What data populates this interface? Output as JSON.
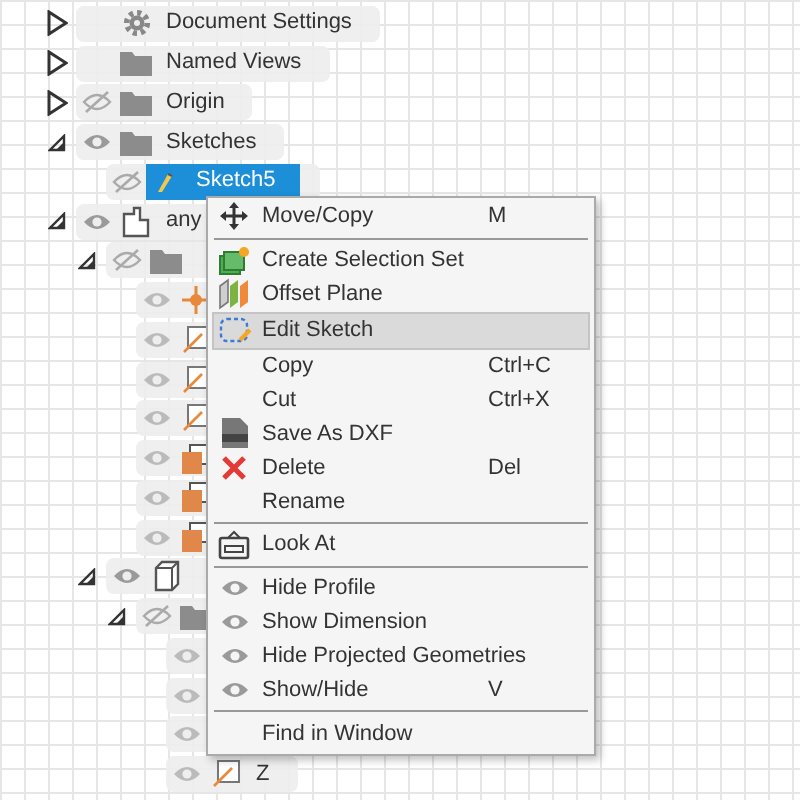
{
  "tree": [
    {
      "label": "Document Settings",
      "kind": "gear",
      "expanded": false,
      "selected": false
    },
    {
      "label": "Named Views",
      "kind": "folder",
      "expanded": false,
      "selected": false
    },
    {
      "label": "Origin",
      "kind": "folder",
      "expanded": false,
      "eye": false,
      "selected": false
    },
    {
      "label": "Sketches",
      "kind": "folder",
      "expanded": true,
      "eye": true,
      "selected": false,
      "children": [
        {
          "label": "Sketch5",
          "kind": "sketch",
          "eye": false,
          "selected": true
        }
      ]
    },
    {
      "label": "any",
      "kind": "component",
      "expanded": true,
      "eye": true,
      "selected": false,
      "children": [
        {
          "kind": "folder",
          "expanded": true,
          "eye": false,
          "selected": false,
          "children": [
            {
              "kind": "point",
              "eye": true,
              "selected": false
            },
            {
              "kind": "line",
              "eye": true,
              "selected": false
            },
            {
              "kind": "line",
              "eye": true,
              "selected": false
            },
            {
              "kind": "line",
              "eye": true,
              "selected": false
            },
            {
              "kind": "profile",
              "eye": true,
              "selected": false
            },
            {
              "kind": "profile",
              "eye": true,
              "selected": false
            },
            {
              "kind": "profile",
              "eye": true,
              "selected": false
            }
          ]
        },
        {
          "kind": "body",
          "expanded": true,
          "eye": true,
          "selected": false,
          "children": [
            {
              "kind": "folder",
              "expanded": true,
              "eye": false,
              "selected": false,
              "children": [
                {
                  "eye": true
                },
                {
                  "eye": true
                },
                {
                  "eye": true
                },
                {
                  "label": "Z",
                  "kind": "line",
                  "eye": true,
                  "selected": false
                }
              ]
            }
          ]
        }
      ]
    }
  ],
  "menu": [
    {
      "kind": "move",
      "label": "Move/Copy",
      "shortcut": "M",
      "selected": false
    },
    {
      "kind": "separator"
    },
    {
      "kind": "selection-set",
      "label": "Create Selection Set",
      "selected": false
    },
    {
      "kind": "offset-plane",
      "label": "Offset Plane",
      "selected": false
    },
    {
      "kind": "edit-sketch",
      "label": "Edit Sketch",
      "selected": true
    },
    {
      "kind": "plain",
      "label": "Copy",
      "shortcut": "Ctrl+C",
      "selected": false
    },
    {
      "kind": "plain",
      "label": "Cut",
      "shortcut": "Ctrl+X",
      "selected": false
    },
    {
      "kind": "dxf",
      "label": "Save As DXF",
      "selected": false
    },
    {
      "kind": "delete",
      "label": "Delete",
      "shortcut": "Del",
      "selected": false
    },
    {
      "kind": "plain",
      "label": "Rename",
      "selected": false
    },
    {
      "kind": "separator"
    },
    {
      "kind": "look-at",
      "label": "Look At",
      "selected": false
    },
    {
      "kind": "separator"
    },
    {
      "kind": "eye",
      "label": "Hide Profile",
      "selected": false
    },
    {
      "kind": "eye",
      "label": "Show Dimension",
      "selected": false
    },
    {
      "kind": "eye",
      "label": "Hide Projected Geometries",
      "selected": false
    },
    {
      "kind": "eye",
      "label": "Show/Hide",
      "shortcut": "V",
      "selected": false
    },
    {
      "kind": "separator"
    },
    {
      "kind": "plain",
      "label": "Find in Window",
      "selected": false
    }
  ]
}
